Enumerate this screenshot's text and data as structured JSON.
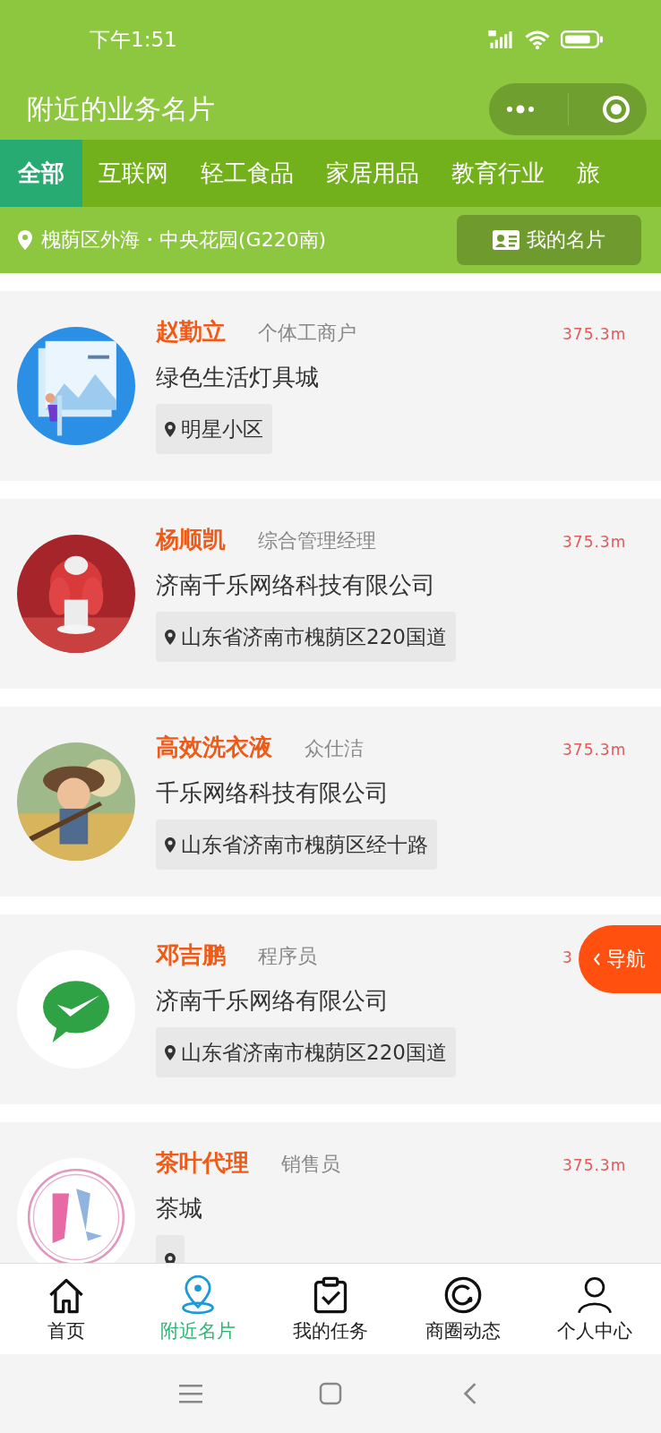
{
  "status_bar": {
    "time": "下午1:51"
  },
  "title_bar": {
    "title": "附近的业务名片"
  },
  "tabs": [
    {
      "label": "全部",
      "selected": true
    },
    {
      "label": "互联网",
      "selected": false
    },
    {
      "label": "轻工食品",
      "selected": false
    },
    {
      "label": "家居用品",
      "selected": false
    },
    {
      "label": "教育行业",
      "selected": false
    },
    {
      "label": "旅",
      "selected": false
    }
  ],
  "location_bar": {
    "location": "槐荫区外海・中央花园(G220南)",
    "my_card_button": "我的名片"
  },
  "cards": [
    {
      "name": "赵勤立",
      "role": "个体工商户",
      "distance": "375.3m",
      "company": "绿色生活灯具城",
      "address": "明星小区"
    },
    {
      "name": "杨顺凯",
      "role": "综合管理经理",
      "distance": "375.3m",
      "company": "济南千乐网络科技有限公司",
      "address": "山东省济南市槐荫区220国道"
    },
    {
      "name": "高效洗衣液",
      "role": "众仕洁",
      "distance": "375.3m",
      "company": "千乐网络科技有限公司",
      "address": "山东省济南市槐荫区经十路"
    },
    {
      "name": "邓吉鹏",
      "role": "程序员",
      "distance": "3",
      "company": "济南千乐网络有限公司",
      "address": "山东省济南市槐荫区220国道"
    },
    {
      "name": "茶叶代理",
      "role": "销售员",
      "distance": "375.3m",
      "company": "茶城"
    }
  ],
  "float_button": {
    "label": "导航"
  },
  "bottom_nav": [
    {
      "label": "首页",
      "selected": false
    },
    {
      "label": "附近名片",
      "selected": true
    },
    {
      "label": "我的任务",
      "selected": false
    },
    {
      "label": "商圈动态",
      "selected": false
    },
    {
      "label": "个人中心",
      "selected": false
    }
  ]
}
